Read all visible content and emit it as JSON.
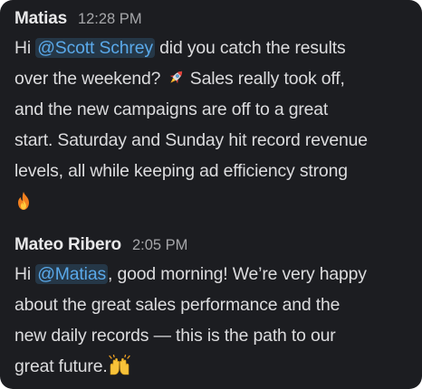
{
  "messages": [
    {
      "author": "Matias",
      "time": "12:28 PM",
      "pre": "Hi ",
      "mention": "@Scott Schrey",
      "line1_rest": " did you catch the results",
      "line2": "over the weekend? ",
      "emoji1": "rocket",
      "line2_rest": " Sales really took off,",
      "line3": "and the new campaigns are off to a great",
      "line4": "start. Saturday and Sunday hit record revenue",
      "line5": "levels, all while keeping ad efficiency strong",
      "emoji2": "fire"
    },
    {
      "author": "Mateo Ribero",
      "time": "2:05 PM",
      "pre": "Hi ",
      "mention": "@Matias",
      "line1_rest": ", good morning! We’re very happy",
      "line2": "about the great sales performance and the",
      "line3": "new daily records — this is the path to our",
      "line4": "great future.",
      "emoji1": "raised-hands"
    }
  ],
  "colors": {
    "background": "#1c1d21",
    "author": "#e8e8e9",
    "timestamp": "#a6a7aa",
    "text": "#dcdcde",
    "mention_text": "#5aa9ea",
    "mention_bg": "#253747"
  }
}
